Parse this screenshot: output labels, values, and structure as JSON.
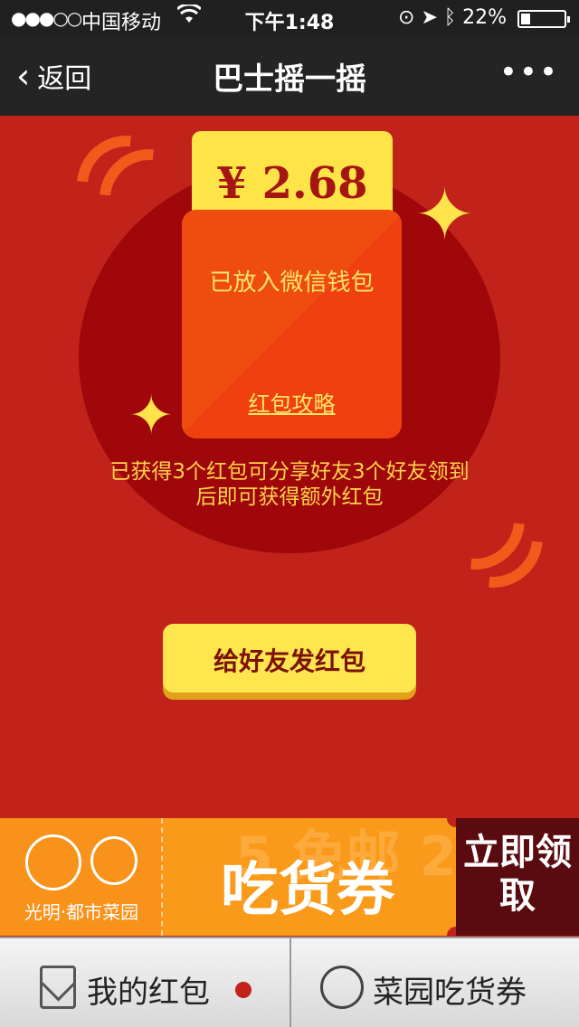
{
  "status_bar": {
    "signal": "●●●○○",
    "carrier": "中国移动",
    "time": "下午1:48",
    "battery": "22%"
  },
  "nav": {
    "back_label": "返回",
    "title": "巴士摇一摇",
    "more": "•••"
  },
  "packet": {
    "amount": "¥ 2.68",
    "status": "已放入微信钱包",
    "guide_link": "红包攻略"
  },
  "info_text": "已获得3个红包可分享好友3个好友领到后即可获得额外红包",
  "share_button": "给好友发红包",
  "ad": {
    "brand": "光明·都市菜园",
    "headline": "吃货券",
    "bg_text": "5 免邮 2",
    "cta": "立即领取"
  },
  "tabs": {
    "my_packets": "我的红包",
    "vouchers": "菜园吃货券"
  },
  "colors": {
    "background": "#c1221a",
    "accent_yellow": "#ffe448",
    "banner_orange": "#f99a1b"
  }
}
